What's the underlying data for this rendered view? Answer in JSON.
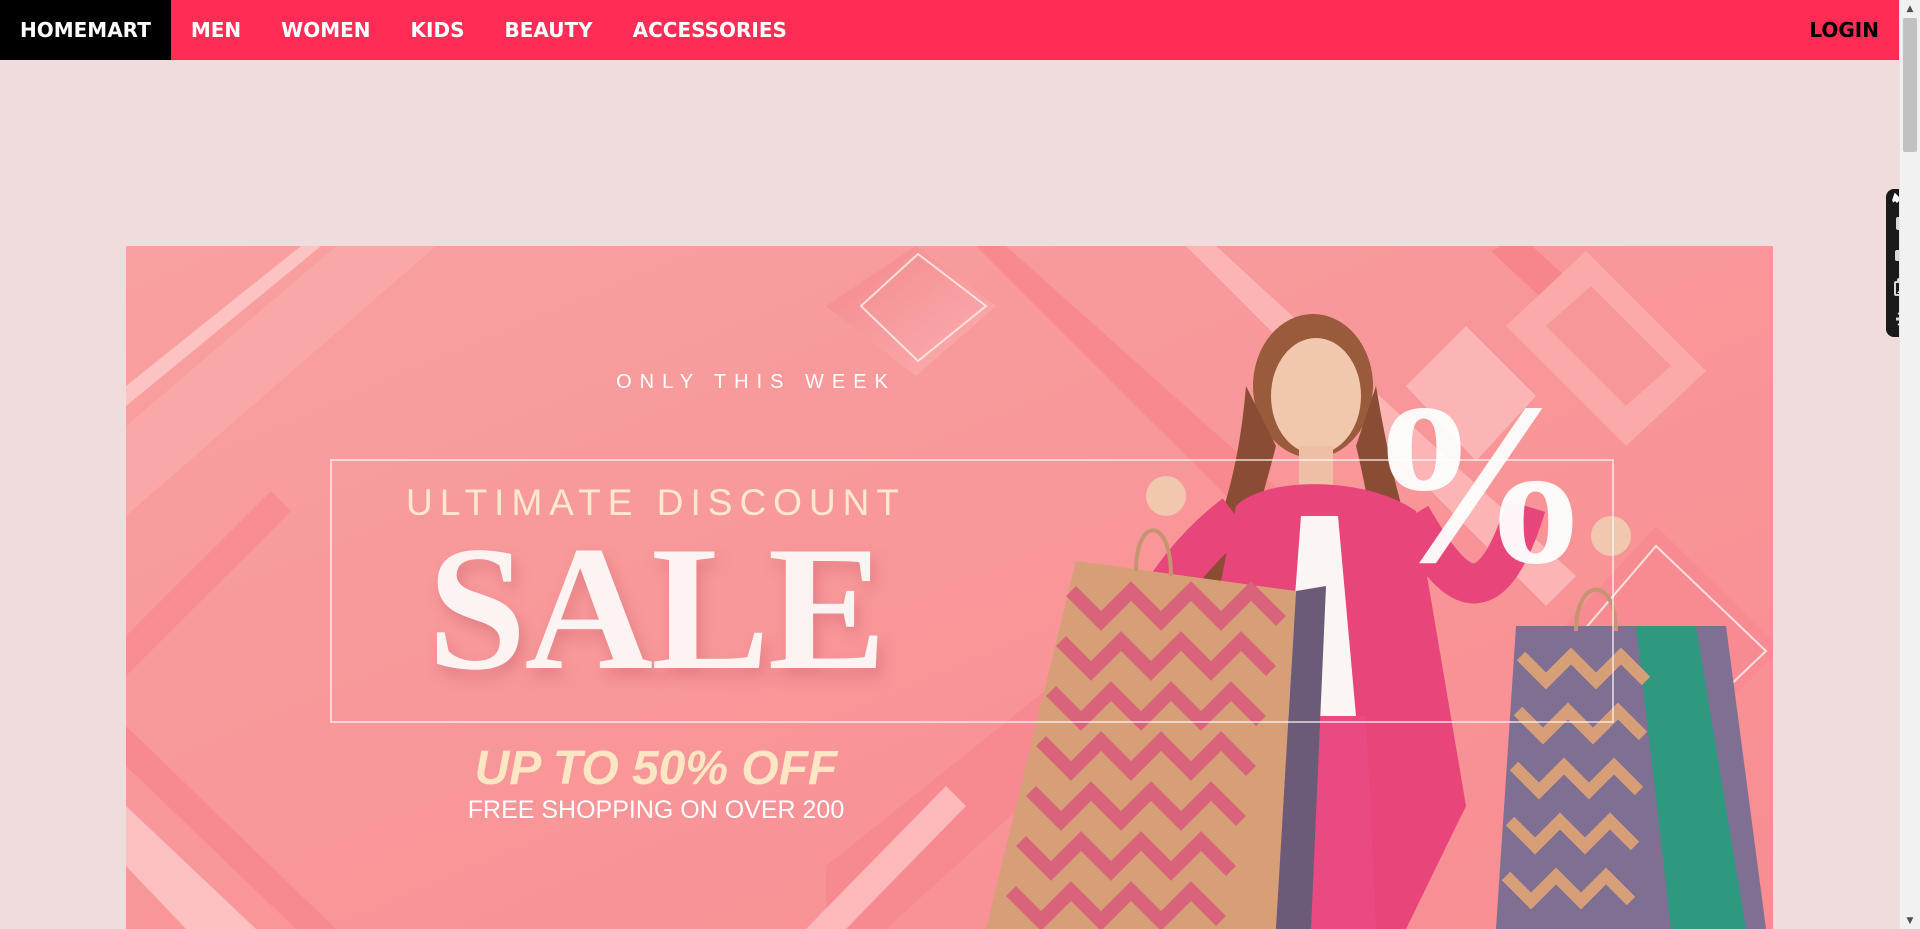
{
  "nav": {
    "brand": "HOMEMART",
    "items": [
      {
        "label": "MEN"
      },
      {
        "label": "WOMEN"
      },
      {
        "label": "KIDS"
      },
      {
        "label": "BEAUTY"
      },
      {
        "label": "ACCESSORIES"
      }
    ],
    "login": "LOGIN"
  },
  "hero": {
    "tagline": "ONLY THIS WEEK",
    "heading_small": "ULTIMATE DISCOUNT",
    "heading_big": "SALE",
    "offer": "UP TO 50% OFF",
    "subline": "FREE SHOPPING ON OVER 200",
    "percent_symbol": "%"
  },
  "tools": {
    "icons": [
      "pin-icon",
      "camera-icon",
      "video-camera-icon",
      "gallery-icon",
      "gear-icon"
    ]
  },
  "colors": {
    "navbar": "#ff2d55",
    "brand_bg": "#000000",
    "page_bg": "#f0dcdc",
    "hero_bg": "#fb9c9c",
    "jacket": "#e8457b",
    "offer_text": "#fde6c4"
  }
}
